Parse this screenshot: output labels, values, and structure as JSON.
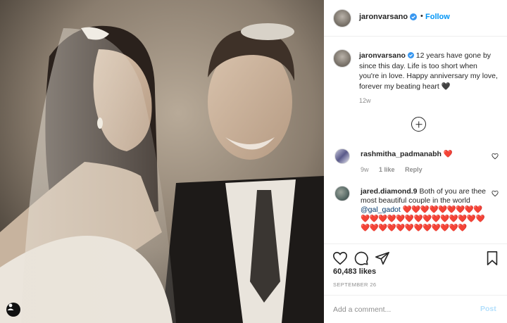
{
  "post": {
    "username": "jaronvarsano",
    "follow_label": "Follow",
    "separator": "•",
    "photo_alt": "Wedding photo of a bride and groom smiling at each other"
  },
  "caption": {
    "username": "jaronvarsano",
    "text": "12 years have gone by since this day. Life is too short when you're in love. Happy anniversary my love, forever my beating heart 🖤",
    "time": "12w"
  },
  "comments": [
    {
      "username": "rashmitha_padmanabh",
      "text": "❤️",
      "time": "9w",
      "likes": "1 like",
      "reply_label": "Reply"
    },
    {
      "username": "jared.diamond.9",
      "text_before": "Both of you are thee most beautiful couple in the world",
      "mention": "@gal_gadot",
      "hearts": "❤️❤️❤️❤️❤️❤️❤️❤️❤️❤️❤️❤️❤️❤️❤️❤️❤️❤️❤️❤️❤️❤️❤️❤️❤️❤️❤️❤️❤️❤️❤️❤️❤️❤️❤️"
    }
  ],
  "engagement": {
    "likes": "60,483 likes",
    "date": "SEPTEMBER 26"
  },
  "add_comment": {
    "placeholder": "Add a comment...",
    "post_label": "Post"
  },
  "colors": {
    "follow_blue": "#0095f6",
    "verified_blue": "#3897f0",
    "heart_red": "#ed4956",
    "muted_gray": "#8e8e8e",
    "post_disabled": "#b2dffc"
  },
  "icons": [
    "user-tag-icon",
    "verified-badge-icon",
    "load-more-comments-icon",
    "heart-outline-icon",
    "comment-icon",
    "share-icon",
    "bookmark-icon"
  ]
}
